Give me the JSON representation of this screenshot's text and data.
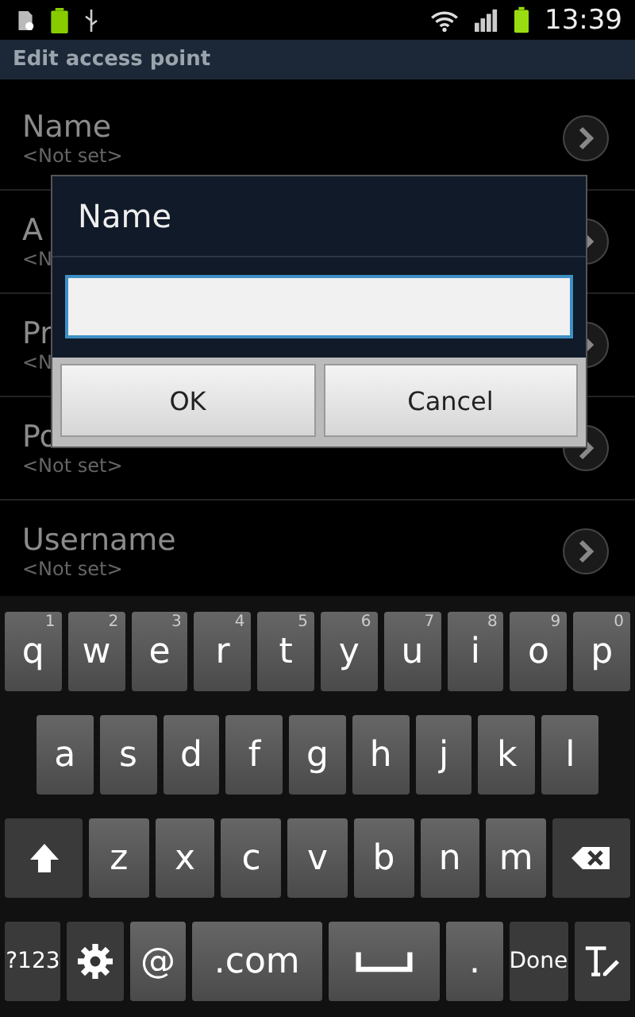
{
  "status_bar": {
    "time": "13:39"
  },
  "title_bar": {
    "title": "Edit access point"
  },
  "settings": [
    {
      "title": "Name",
      "value": "<Not set>"
    },
    {
      "title": "A",
      "value": "<N"
    },
    {
      "title": "Pr",
      "value": "<N"
    },
    {
      "title": "Po",
      "value": "<Not set>"
    },
    {
      "title": "Username",
      "value": "<Not set>"
    }
  ],
  "dialog": {
    "title": "Name",
    "buttons": [
      "OK",
      "Cancel"
    ]
  },
  "keyboard": {
    "rows": [
      [
        {
          "kind": "letter",
          "label": "q",
          "hint": "1"
        },
        {
          "kind": "letter",
          "label": "w",
          "hint": "2"
        },
        {
          "kind": "letter",
          "label": "e",
          "hint": "3"
        },
        {
          "kind": "letter",
          "label": "r",
          "hint": "4"
        },
        {
          "kind": "letter",
          "label": "t",
          "hint": "5"
        },
        {
          "kind": "letter",
          "label": "y",
          "hint": "6"
        },
        {
          "kind": "letter",
          "label": "u",
          "hint": "7"
        },
        {
          "kind": "letter",
          "label": "i",
          "hint": "8"
        },
        {
          "kind": "letter",
          "label": "o",
          "hint": "9"
        },
        {
          "kind": "letter",
          "label": "p",
          "hint": "0"
        }
      ],
      [
        {
          "kind": "letter",
          "label": "a"
        },
        {
          "kind": "letter",
          "label": "s"
        },
        {
          "kind": "letter",
          "label": "d"
        },
        {
          "kind": "letter",
          "label": "f"
        },
        {
          "kind": "letter",
          "label": "g"
        },
        {
          "kind": "letter",
          "label": "h"
        },
        {
          "kind": "letter",
          "label": "j"
        },
        {
          "kind": "letter",
          "label": "k"
        },
        {
          "kind": "letter",
          "label": "l"
        }
      ],
      [
        {
          "kind": "shift"
        },
        {
          "kind": "letter",
          "label": "z"
        },
        {
          "kind": "letter",
          "label": "x"
        },
        {
          "kind": "letter",
          "label": "c"
        },
        {
          "kind": "letter",
          "label": "v"
        },
        {
          "kind": "letter",
          "label": "b"
        },
        {
          "kind": "letter",
          "label": "n"
        },
        {
          "kind": "letter",
          "label": "m"
        },
        {
          "kind": "backspace"
        }
      ],
      [
        {
          "kind": "function",
          "label": "?123"
        },
        {
          "kind": "settings"
        },
        {
          "kind": "letter",
          "label": "@"
        },
        {
          "kind": "wide",
          "label": ".com"
        },
        {
          "kind": "space"
        },
        {
          "kind": "letter",
          "label": "."
        },
        {
          "kind": "function",
          "label": "Done"
        },
        {
          "kind": "textmode"
        }
      ]
    ]
  }
}
